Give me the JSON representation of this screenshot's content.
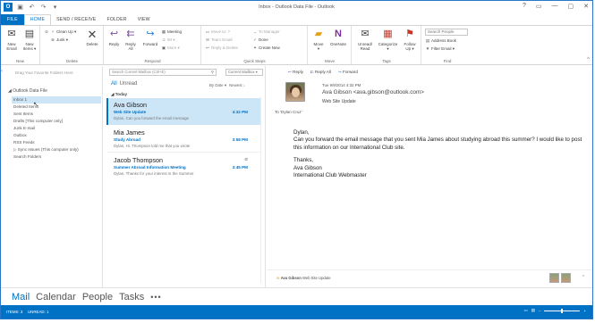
{
  "titlebar": {
    "title": "Inbox - Outlook Data File - Outlook",
    "app_icon": "O",
    "qat": [
      "save-icon",
      "undo-icon",
      "redo-icon",
      "customize-icon"
    ],
    "controls": [
      "?",
      "▭",
      "—",
      "▢",
      "✕"
    ]
  },
  "tabs": [
    "FILE",
    "HOME",
    "SEND / RECEIVE",
    "FOLDER",
    "VIEW"
  ],
  "ribbon": {
    "new": {
      "new_email": "New\nEmail",
      "new_items": "New\nItems ▾",
      "label": "New"
    },
    "delete": {
      "ignore": "",
      "clean_up": "Clean Up ▾",
      "junk": "Junk ▾",
      "delete": "Delete",
      "label": "Delete"
    },
    "respond": {
      "reply": "Reply",
      "reply_all": "Reply\nAll",
      "forward": "Forward",
      "meeting": "Meeting",
      "im": "IM ▾",
      "more": "More ▾",
      "label": "Respond"
    },
    "quick_steps": {
      "move_to": "Move to: ?",
      "team_email": "Team Email",
      "reply_delete": "Reply & Delete",
      "to_manager": "To Manager",
      "done": "Done",
      "create_new": "Create New",
      "label": "Quick Steps"
    },
    "move": {
      "move": "Move\n▾",
      "onenote": "OneNote",
      "label": "Move"
    },
    "tags": {
      "unread_read": "Unread/\nRead",
      "categorize": "Categorize\n▾",
      "follow_up": "Follow\nUp ▾",
      "label": "Tags"
    },
    "find": {
      "search_people": "Search People",
      "address_book": "Address Book",
      "filter_email": "Filter Email ▾",
      "label": "Find"
    }
  },
  "folders": {
    "drag_hint": "Drag Your Favorite Folders Here",
    "root": "◢ Outlook Data File",
    "items": [
      {
        "label": "Inbox 1"
      },
      {
        "label": "Deleted Items"
      },
      {
        "label": "Sent Items"
      },
      {
        "label": "Drafts [This computer only]"
      },
      {
        "label": "Junk E-mail"
      },
      {
        "label": "Outbox"
      },
      {
        "label": "RSS Feeds"
      },
      {
        "label": "▷ Sync Issues (This computer only)"
      },
      {
        "label": "Search Folders"
      }
    ]
  },
  "messages": {
    "search_placeholder": "Search Current Mailbox (Ctrl+E)",
    "scope": "Current Mailbox ▾",
    "filter_all": "All",
    "filter_unread": "Unread",
    "sort_by": "By Date ▾",
    "sort_order": "Newest ↓",
    "group": "◢ Today",
    "list": [
      {
        "from": "Ava Gibson",
        "subject": "Web Site Update",
        "time": "4:32 PM",
        "preview": "Dylan,  Can you forward the email message",
        "attachment": false
      },
      {
        "from": "Mia James",
        "subject": "Study Abroad",
        "time": "3:58 PM",
        "preview": "Dylan,  Hi. Thompson told me that you wrote",
        "attachment": false
      },
      {
        "from": "Jacob Thompson",
        "subject": "Summer Abroad Information Meeting",
        "time": "3:45 PM",
        "preview": "Dylan,  Thanks for your interest in the Summer",
        "attachment": true
      }
    ]
  },
  "reading": {
    "actions": [
      "Reply",
      "Reply All",
      "Forward"
    ],
    "date": "Tue 9/9/2014 4:32 PM",
    "from": "Ava Gibson <ava.gibson@outlook.com>",
    "subject": "Web Site Update",
    "to": "To    'Dylan Cruz'",
    "body": [
      "Dylan,",
      "Can you forward the email message that you sent Mia James about studying abroad this summer? I would like to post this information on our International Club site.",
      "",
      "Thanks,",
      "Ava Gibson",
      "International Club Webmaster"
    ],
    "footer_from": "Ava Gibson",
    "footer_subject": "Web Site Update"
  },
  "nav": [
    "Mail",
    "Calendar",
    "People",
    "Tasks",
    "•••"
  ],
  "status": {
    "items": "ITEMS: 3",
    "unread": "UNREAD: 1"
  },
  "colors": {
    "accent": "#0072c6",
    "selection": "#cde6f7"
  }
}
